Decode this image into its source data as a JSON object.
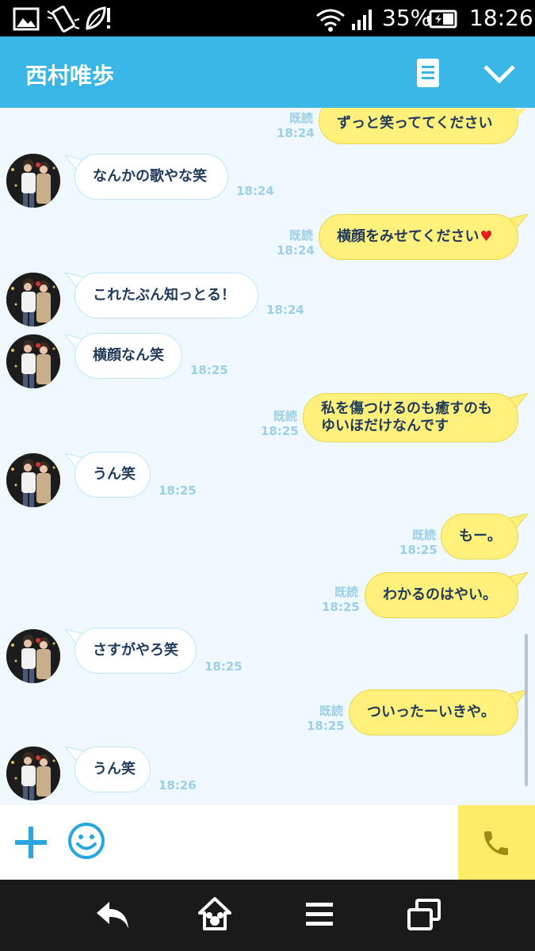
{
  "status_bar": {
    "battery": "35%",
    "time": "18:26",
    "icons": [
      "gallery-icon",
      "screen-rotate-icon",
      "leaf-alert-icon",
      "wifi-icon",
      "signal-icon",
      "battery-icon"
    ]
  },
  "header": {
    "title": "西村唯歩",
    "icons": [
      "notes-icon",
      "chevron-down-icon"
    ]
  },
  "chat": {
    "read_label": "既読",
    "messages": [
      {
        "dir": "out",
        "text": "ずっと笑っててください",
        "time": "18:24"
      },
      {
        "dir": "in",
        "text": "なんかの歌やな笑",
        "time": "18:24"
      },
      {
        "dir": "out",
        "text": "横顔をみせてください",
        "time": "18:24",
        "emoji": "♥"
      },
      {
        "dir": "in",
        "text": "これたぶん知っとる！",
        "time": "18:24"
      },
      {
        "dir": "in",
        "text": "横顔なん笑",
        "time": "18:25"
      },
      {
        "dir": "out",
        "lines": [
          "私を傷つけるのも癒すのも",
          "ゆいほだけなんです"
        ],
        "time": "18:25"
      },
      {
        "dir": "in",
        "text": "うん笑",
        "time": "18:25"
      },
      {
        "dir": "out",
        "text": "もー。",
        "time": "18:25"
      },
      {
        "dir": "out",
        "text": "わかるのはやい。",
        "time": "18:25"
      },
      {
        "dir": "in",
        "text": "さすがやろ笑",
        "time": "18:25"
      },
      {
        "dir": "out",
        "text": "ついったーいきや。",
        "time": "18:25"
      },
      {
        "dir": "in",
        "text": "うん笑",
        "time": "18:26"
      }
    ]
  },
  "input_bar": {
    "icons": [
      "plus-icon",
      "emoji-icon",
      "phone-icon"
    ]
  },
  "nav_bar": {
    "icons": [
      "back-icon",
      "home-icon",
      "menu-icon",
      "recent-apps-icon"
    ]
  },
  "colors": {
    "header": "#3ab6e6",
    "chat_bg": "#eef8fd",
    "out_bubble": "#fff07c",
    "in_bubble": "#ffffff",
    "text": "#1f3a5c",
    "time": "#9ccfe6"
  }
}
